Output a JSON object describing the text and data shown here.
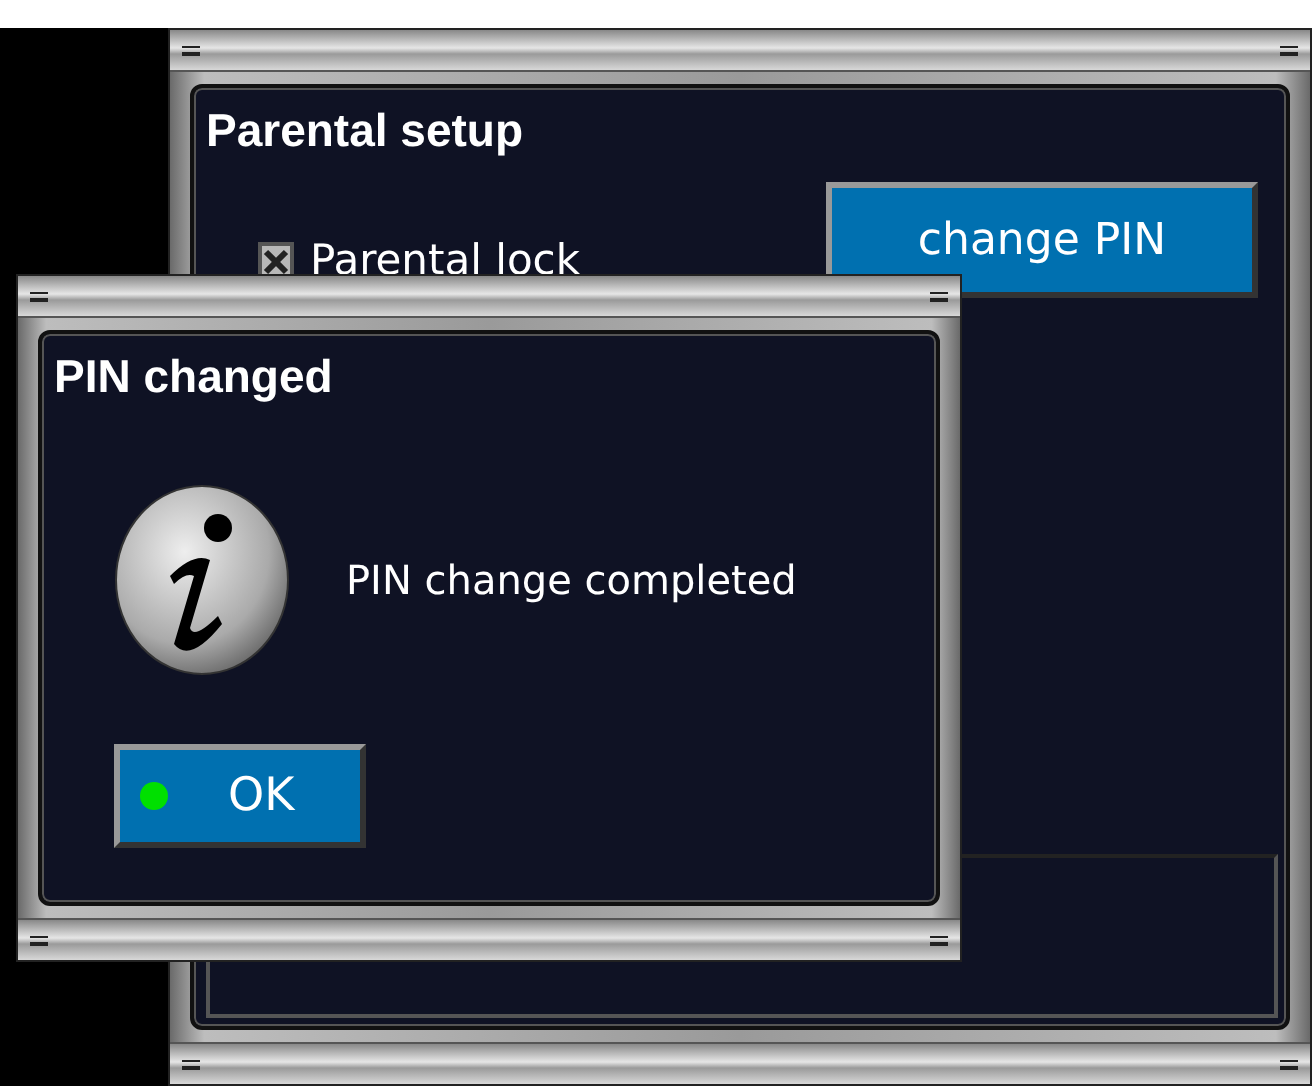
{
  "window": {
    "title": "Parental setup"
  },
  "parental_lock": {
    "label": "Parental lock",
    "checked": true
  },
  "change_pin_button": {
    "label": "change PIN"
  },
  "dialog": {
    "title": "PIN changed",
    "kind": "info",
    "message": "PIN change completed",
    "buttons": [
      {
        "label": "OK",
        "selected": true
      }
    ]
  }
}
